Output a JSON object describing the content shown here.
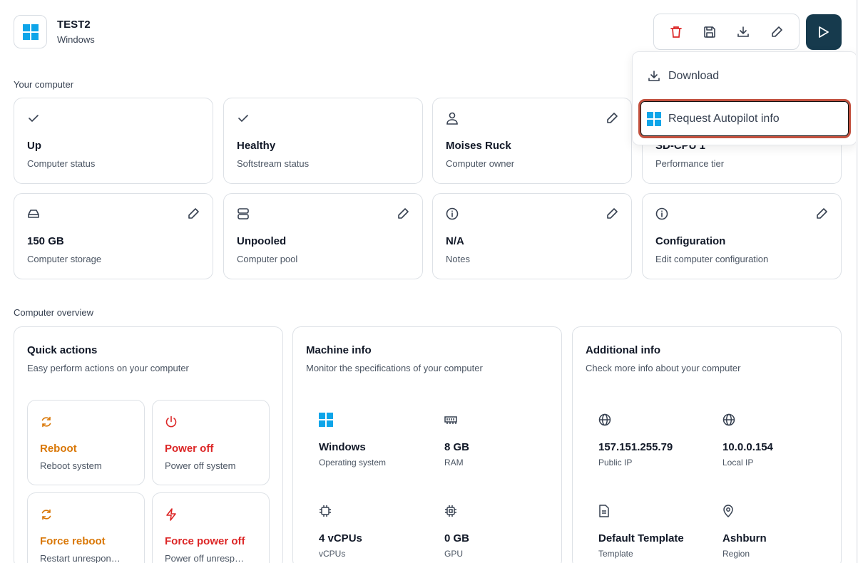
{
  "header": {
    "title": "TEST2",
    "subtitle": "Windows"
  },
  "toolbar": {
    "icons": [
      "trash-icon",
      "save-icon",
      "download-icon",
      "pencil-icon"
    ],
    "play_icon": "play-icon",
    "danger_color": "#dc2626",
    "primary_color": "#163a4d"
  },
  "dropdown": {
    "items": [
      {
        "label": "Download",
        "icon": "download-icon"
      },
      {
        "label": "Request Autopilot info",
        "icon": "windows-logo-icon"
      }
    ],
    "highlight_color": "#c2503e"
  },
  "sections": {
    "your_computer": "Your computer",
    "computer_overview": "Computer overview"
  },
  "status_cards": [
    {
      "icon": "check-icon",
      "value": "Up",
      "label": "Computer status",
      "editable": false
    },
    {
      "icon": "check-icon",
      "value": "Healthy",
      "label": "Softstream status",
      "editable": false
    },
    {
      "icon": "user-icon",
      "value": "Moises Ruck",
      "label": "Computer owner",
      "editable": true
    },
    {
      "icon": "cpu-icon",
      "value": "SD-CPU 1",
      "label": "Performance tier",
      "editable": true
    },
    {
      "icon": "drive-icon",
      "value": "150 GB",
      "label": "Computer storage",
      "editable": true
    },
    {
      "icon": "server-icon",
      "value": "Unpooled",
      "label": "Computer pool",
      "editable": true
    },
    {
      "icon": "info-icon",
      "value": "N/A",
      "label": "Notes",
      "editable": true
    },
    {
      "icon": "info-icon",
      "value": "Configuration",
      "label": "Edit computer configuration",
      "editable": true
    }
  ],
  "quick_actions": {
    "title": "Quick actions",
    "subtitle": "Easy perform actions on your computer",
    "actions": [
      {
        "icon": "refresh-icon",
        "title": "Reboot",
        "subtitle": "Reboot system",
        "color": "#d97706"
      },
      {
        "icon": "power-icon",
        "title": "Power off",
        "subtitle": "Power off system",
        "color": "#dc2626"
      },
      {
        "icon": "refresh-icon",
        "title": "Force reboot",
        "subtitle": "Restart unrespon…",
        "color": "#d97706"
      },
      {
        "icon": "bolt-icon",
        "title": "Force power off",
        "subtitle": "Power off unresp…",
        "color": "#dc2626"
      }
    ]
  },
  "machine_info": {
    "title": "Machine info",
    "subtitle": "Monitor the specifications of your computer",
    "items": [
      {
        "icon": "windows-logo-icon",
        "value": "Windows",
        "label": "Operating system"
      },
      {
        "icon": "memory-icon",
        "value": "8 GB",
        "label": "RAM"
      },
      {
        "icon": "cpu-icon",
        "value": "4 vCPUs",
        "label": "vCPUs"
      },
      {
        "icon": "gpu-icon",
        "value": "0 GB",
        "label": "GPU"
      }
    ]
  },
  "additional_info": {
    "title": "Additional info",
    "subtitle": "Check more info about your computer",
    "items": [
      {
        "icon": "globe-icon",
        "value": "157.151.255.79",
        "label": "Public IP"
      },
      {
        "icon": "globe-icon",
        "value": "10.0.0.154",
        "label": "Local IP"
      },
      {
        "icon": "document-icon",
        "value": "Default Template",
        "label": "Template"
      },
      {
        "icon": "location-pin-icon",
        "value": "Ashburn",
        "label": "Region"
      }
    ]
  }
}
